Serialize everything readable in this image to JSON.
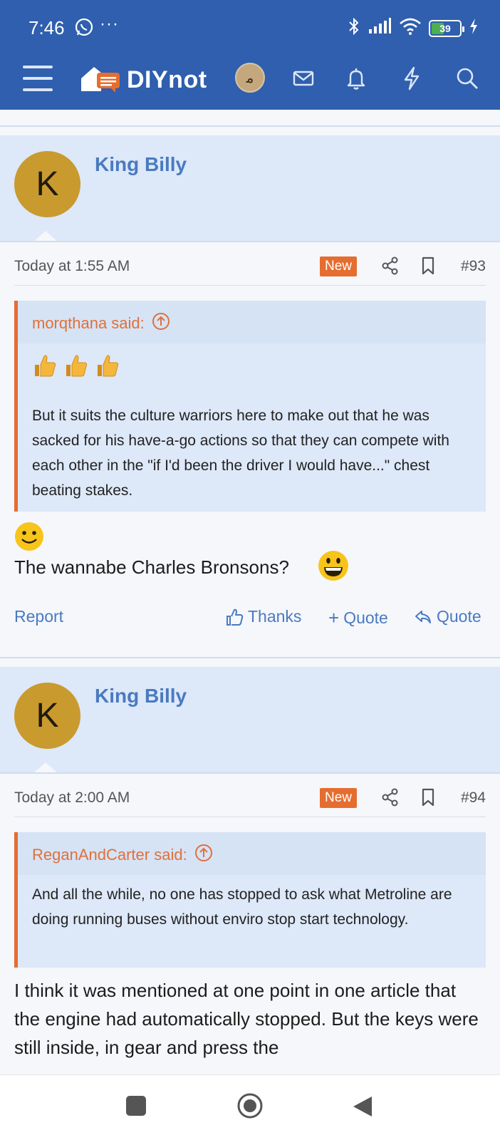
{
  "status_bar": {
    "time": "7:46",
    "battery": "39"
  },
  "nav": {
    "logo_text": "DIYnot"
  },
  "posts": [
    {
      "author": "King Billy",
      "avatar_letter": "K",
      "date": "Today at 1:55 AM",
      "badge": "New",
      "number": "#93",
      "quote": {
        "author_label": "morqthana said:",
        "text": "But it suits the culture warriors here to make out that he was sacked for his have-a-go actions so that they can compete with each other in the \"if I'd been the driver I would have...\" chest beating stakes."
      },
      "body_text": "The wannabe Charles Bronsons?",
      "actions": {
        "report": "Report",
        "thanks": "Thanks",
        "multiquote": "Quote",
        "quote": "Quote"
      }
    },
    {
      "author": "King Billy",
      "avatar_letter": "K",
      "date": "Today at 2:00 AM",
      "badge": "New",
      "number": "#94",
      "quote": {
        "author_label": "ReganAndCarter said:",
        "text": "And all the while, no one has stopped to ask what Metroline are doing running buses without enviro stop start technology."
      },
      "body_text": "I think it was mentioned at one point in one article that the engine had automatically stopped. But the keys were still inside, in gear and press the"
    }
  ],
  "colors": {
    "header": "#2f5fae",
    "accent": "#e56d2f",
    "link": "#4a7ac0",
    "avatar": "#c99a2e"
  }
}
